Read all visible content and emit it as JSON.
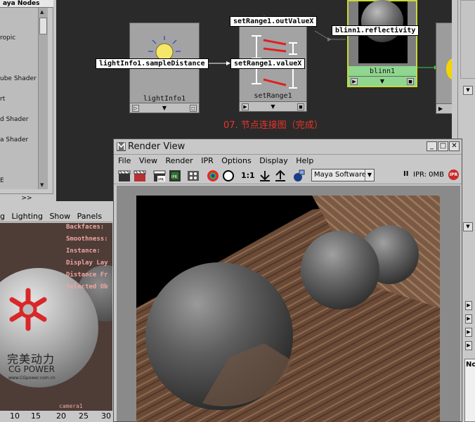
{
  "node_list": {
    "title": "aya Nodes",
    "items": [
      "ropic",
      "ube Shader",
      "rt",
      "d Shader",
      "a Shader",
      "E"
    ],
    "footer": ">>"
  },
  "graph": {
    "caption": "07. 节点连接图（完成）",
    "nodes": {
      "lightinfo": {
        "name": "lightInfo1"
      },
      "setrange": {
        "name": "setRange1"
      },
      "blinn": {
        "name": "blinn1"
      }
    },
    "attrs": {
      "light_attr": "lightInfo1.sampleDistance",
      "out_attr": "setRange1.outValueX",
      "in_attr": "setRange1.valueX",
      "blinn_attr": "blinn1.reflectivity"
    }
  },
  "viewport": {
    "menu": [
      "g",
      "Lighting",
      "Show",
      "Panels"
    ],
    "hud": [
      "Backfaces:",
      "Smoothness:",
      "Instance:",
      "Display Lay",
      "Distance Fr",
      "Selected Ob"
    ],
    "camera": "camera1",
    "ruler": [
      "10",
      "15",
      "20",
      "25",
      "30"
    ],
    "watermark": {
      "cn": "完美动力",
      "en": "CG POWER",
      "url": "www.CGpower.com.cn"
    }
  },
  "render_view": {
    "title": "Render View",
    "menus": [
      "File",
      "View",
      "Render",
      "IPR",
      "Options",
      "Display",
      "Help"
    ],
    "ratio": "1:1",
    "renderer": "Maya Software",
    "ipr_memory": "IPR: 0MB",
    "ipr_badge": "IPR",
    "pause": "II"
  },
  "side_panel": {
    "label": "No"
  }
}
